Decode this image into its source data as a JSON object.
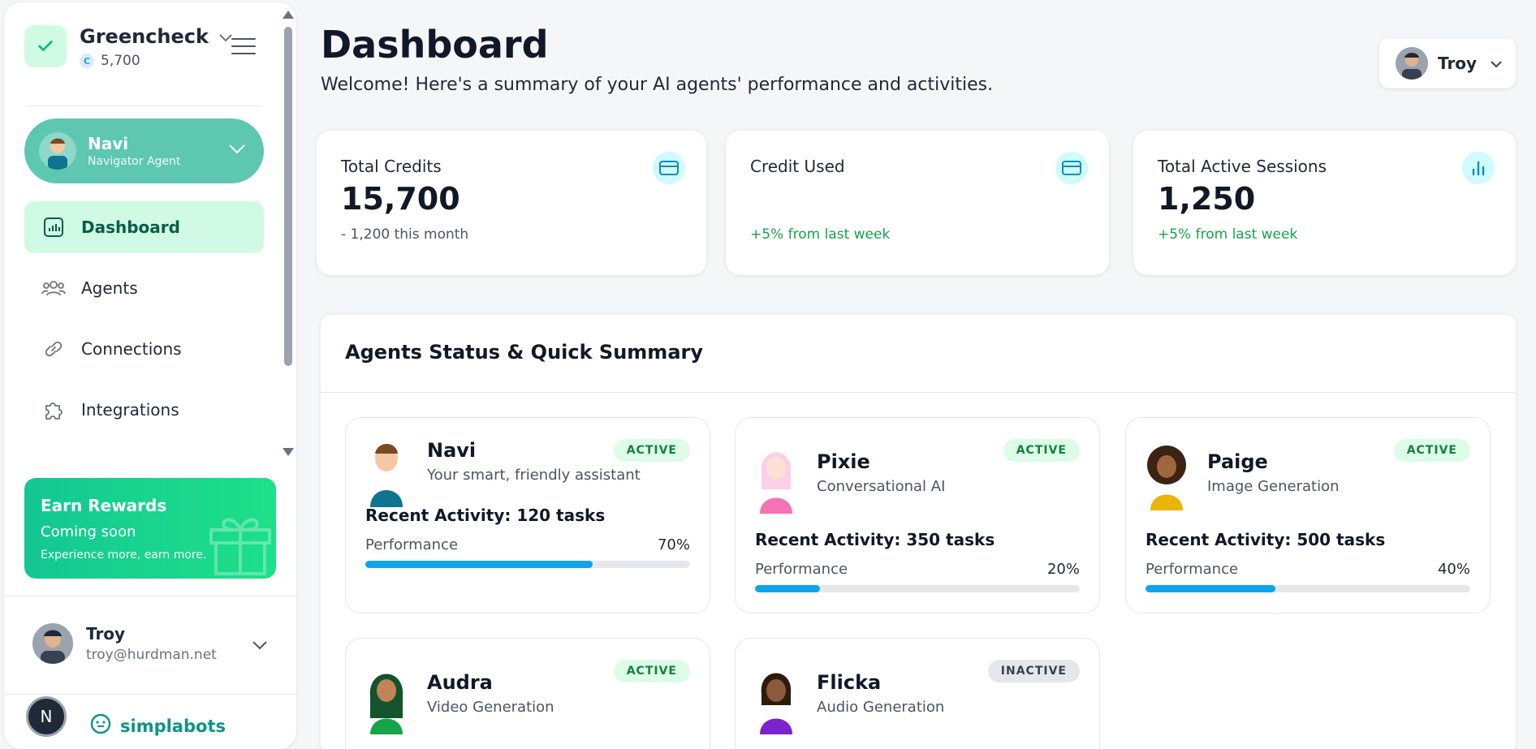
{
  "org": {
    "name": "Greencheck",
    "credits": "5,700",
    "coin_letter": "C"
  },
  "current_agent": {
    "name": "Navi",
    "role": "Navigator Agent"
  },
  "nav": [
    {
      "label": "Dashboard",
      "icon": "bar-chart-icon",
      "active": true
    },
    {
      "label": "Agents",
      "icon": "users-icon",
      "active": false
    },
    {
      "label": "Connections",
      "icon": "link-icon",
      "active": false
    },
    {
      "label": "Integrations",
      "icon": "puzzle-icon",
      "active": false
    }
  ],
  "rewards": {
    "title": "Earn Rewards",
    "status": "Coming soon",
    "tagline": "Experience more, earn more."
  },
  "user": {
    "name": "Troy",
    "email": "troy@hurdman.net"
  },
  "brand": {
    "name": "simplabots"
  },
  "n_badge": "N",
  "header": {
    "title": "Dashboard",
    "subtitle": "Welcome! Here's a summary of your AI agents' performance and activities.",
    "user_name": "Troy"
  },
  "stats": [
    {
      "label": "Total Credits",
      "value": "15,700",
      "sub": "- 1,200 this month",
      "sub_color": "neutral",
      "icon": "credit-card-icon"
    },
    {
      "label": "Credit Used",
      "value": "",
      "sub": "+5% from last week",
      "sub_color": "green",
      "icon": "credit-card-icon"
    },
    {
      "label": "Total Active Sessions",
      "value": "1,250",
      "sub": "+5% from last week",
      "sub_color": "green",
      "icon": "bar-chart-icon"
    }
  ],
  "summary": {
    "title": "Agents Status & Quick Summary",
    "performance_label": "Performance",
    "agents": [
      {
        "name": "Navi",
        "role": "Your smart, friendly assistant",
        "status": "ACTIVE",
        "activity": "Recent Activity: 120 tasks",
        "performance": "70%",
        "performance_value": 0.7,
        "color": "#0e7490"
      },
      {
        "name": "Pixie",
        "role": "Conversational AI",
        "status": "ACTIVE",
        "activity": "Recent Activity: 350 tasks",
        "performance": "20%",
        "performance_value": 0.2,
        "color": "#f472b6"
      },
      {
        "name": "Paige",
        "role": "Image Generation",
        "status": "ACTIVE",
        "activity": "Recent Activity: 500 tasks",
        "performance": "40%",
        "performance_value": 0.4,
        "color": "#eab308"
      },
      {
        "name": "Audra",
        "role": "Video Generation",
        "status": "ACTIVE",
        "color": "#16a34a"
      },
      {
        "name": "Flicka",
        "role": "Audio Generation",
        "status": "INACTIVE",
        "color": "#7e22ce"
      }
    ]
  },
  "colors": {
    "accent": "#14b8a6",
    "active_nav_bg": "#d1fae5",
    "bar_fill": "#0ea5e9",
    "positive": "#16a34a"
  }
}
